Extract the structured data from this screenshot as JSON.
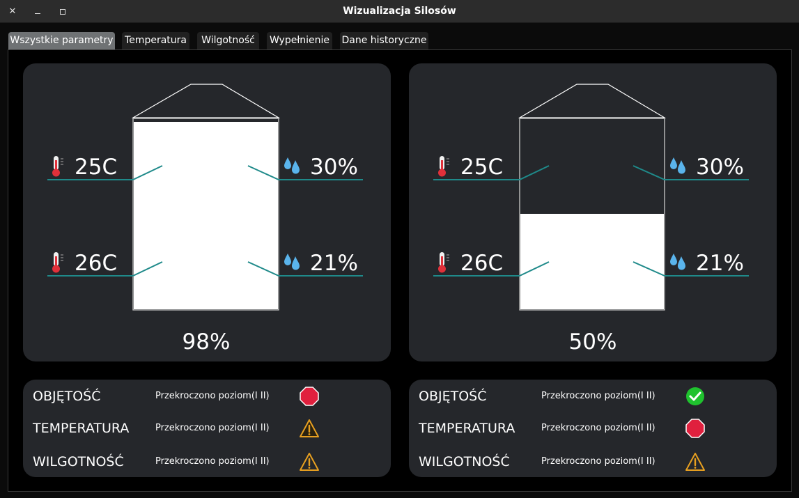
{
  "window": {
    "title": "Wizualizacja Silosów",
    "close_icon": "close-icon",
    "minimize_icon": "minimize-icon",
    "maximize_icon": "maximize-icon"
  },
  "tabs": [
    {
      "label": "Wszystkie parametry",
      "active": true
    },
    {
      "label": "Temperatura",
      "active": false
    },
    {
      "label": "Wilgotność",
      "active": false
    },
    {
      "label": "Wypełnienie",
      "active": false
    },
    {
      "label": "Dane historyczne",
      "active": false
    }
  ],
  "silos": [
    {
      "temp_top": "25C",
      "temp_bottom": "26C",
      "humidity_top": "30%",
      "humidity_bottom": "21%",
      "fill_fraction": 0.98,
      "fill_label": "98%",
      "status": [
        {
          "name": "OBJĘTOŚĆ",
          "text": "Przekroczono poziom(I II)",
          "icon": "stop-icon"
        },
        {
          "name": "TEMPERATURA",
          "text": "Przekroczono poziom(I II)",
          "icon": "warning-icon"
        },
        {
          "name": "WILGOTNOŚĆ",
          "text": "Przekroczono poziom(I II)",
          "icon": "warning-icon"
        }
      ]
    },
    {
      "temp_top": "25C",
      "temp_bottom": "26C",
      "humidity_top": "30%",
      "humidity_bottom": "21%",
      "fill_fraction": 0.5,
      "fill_label": "50%",
      "status": [
        {
          "name": "OBJĘTOŚĆ",
          "text": "Przekroczono poziom(I II)",
          "icon": "check-icon"
        },
        {
          "name": "TEMPERATURA",
          "text": "Przekroczono poziom(I II)",
          "icon": "stop-icon"
        },
        {
          "name": "WILGOTNOŚĆ",
          "text": "Przekroczono poziom(I II)",
          "icon": "warning-icon"
        }
      ]
    }
  ],
  "colors": {
    "panel": "#25272b",
    "sensor_line": "#1f8a8a",
    "stop": "#e0203e",
    "warning": "#e8a020",
    "ok": "#1fc22e",
    "thermo": "#e0303a",
    "drop": "#5ab4ec"
  }
}
